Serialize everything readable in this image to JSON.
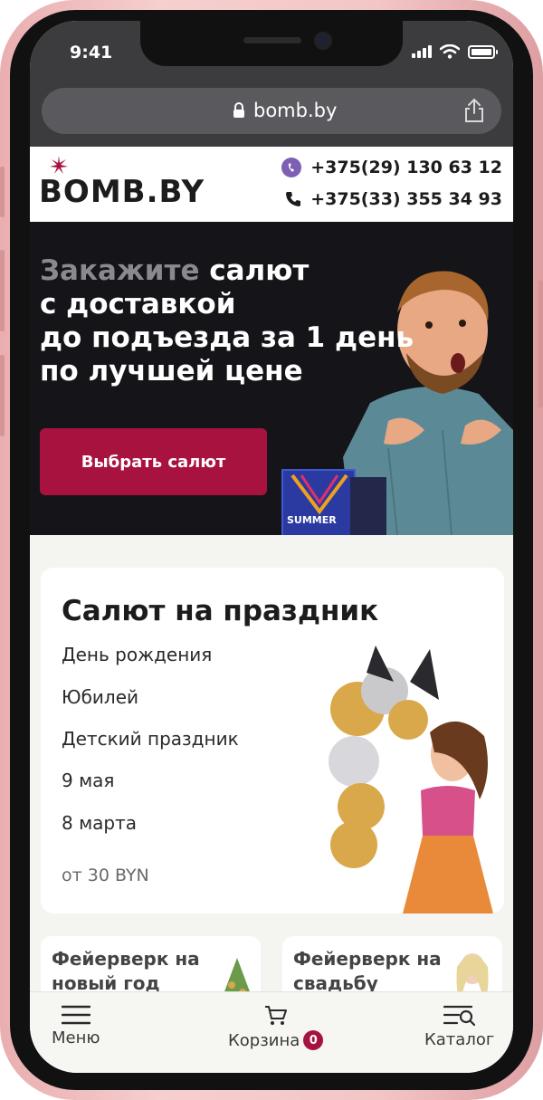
{
  "status_bar": {
    "time": "9:41"
  },
  "browser": {
    "url": "bomb.by",
    "icons": [
      "lock-icon",
      "share-icon"
    ]
  },
  "header": {
    "logo": "BOMB.BY",
    "phones": [
      {
        "number": "+375(29) 130 63 12",
        "icon": "viber-icon"
      },
      {
        "number": "+375(33) 355 34 93",
        "icon": "phone-icon"
      }
    ]
  },
  "hero": {
    "title_muted": "Закажите",
    "title_lines": [
      "салют",
      "с доставкой",
      "до подъезда за 1 день",
      "по лучшей цене"
    ],
    "cta_label": "Выбрать салют",
    "product_label": "SUMMER"
  },
  "holiday_card": {
    "title": "Салют на праздник",
    "items": [
      "День рождения",
      "Юбилей",
      "Детский праздник",
      "9 мая",
      "8 марта"
    ],
    "price": "от 30 BYN"
  },
  "tiles": [
    {
      "title": "Фейерверк на новый год"
    },
    {
      "title": "Фейерверк на свадьбу"
    }
  ],
  "bottom_nav": {
    "menu": "Меню",
    "cart": "Корзина",
    "cart_count": "0",
    "catalog": "Каталог"
  },
  "colors": {
    "accent": "#a8123f",
    "hero_bg": "#141419",
    "viber": "#7d5fb3"
  }
}
